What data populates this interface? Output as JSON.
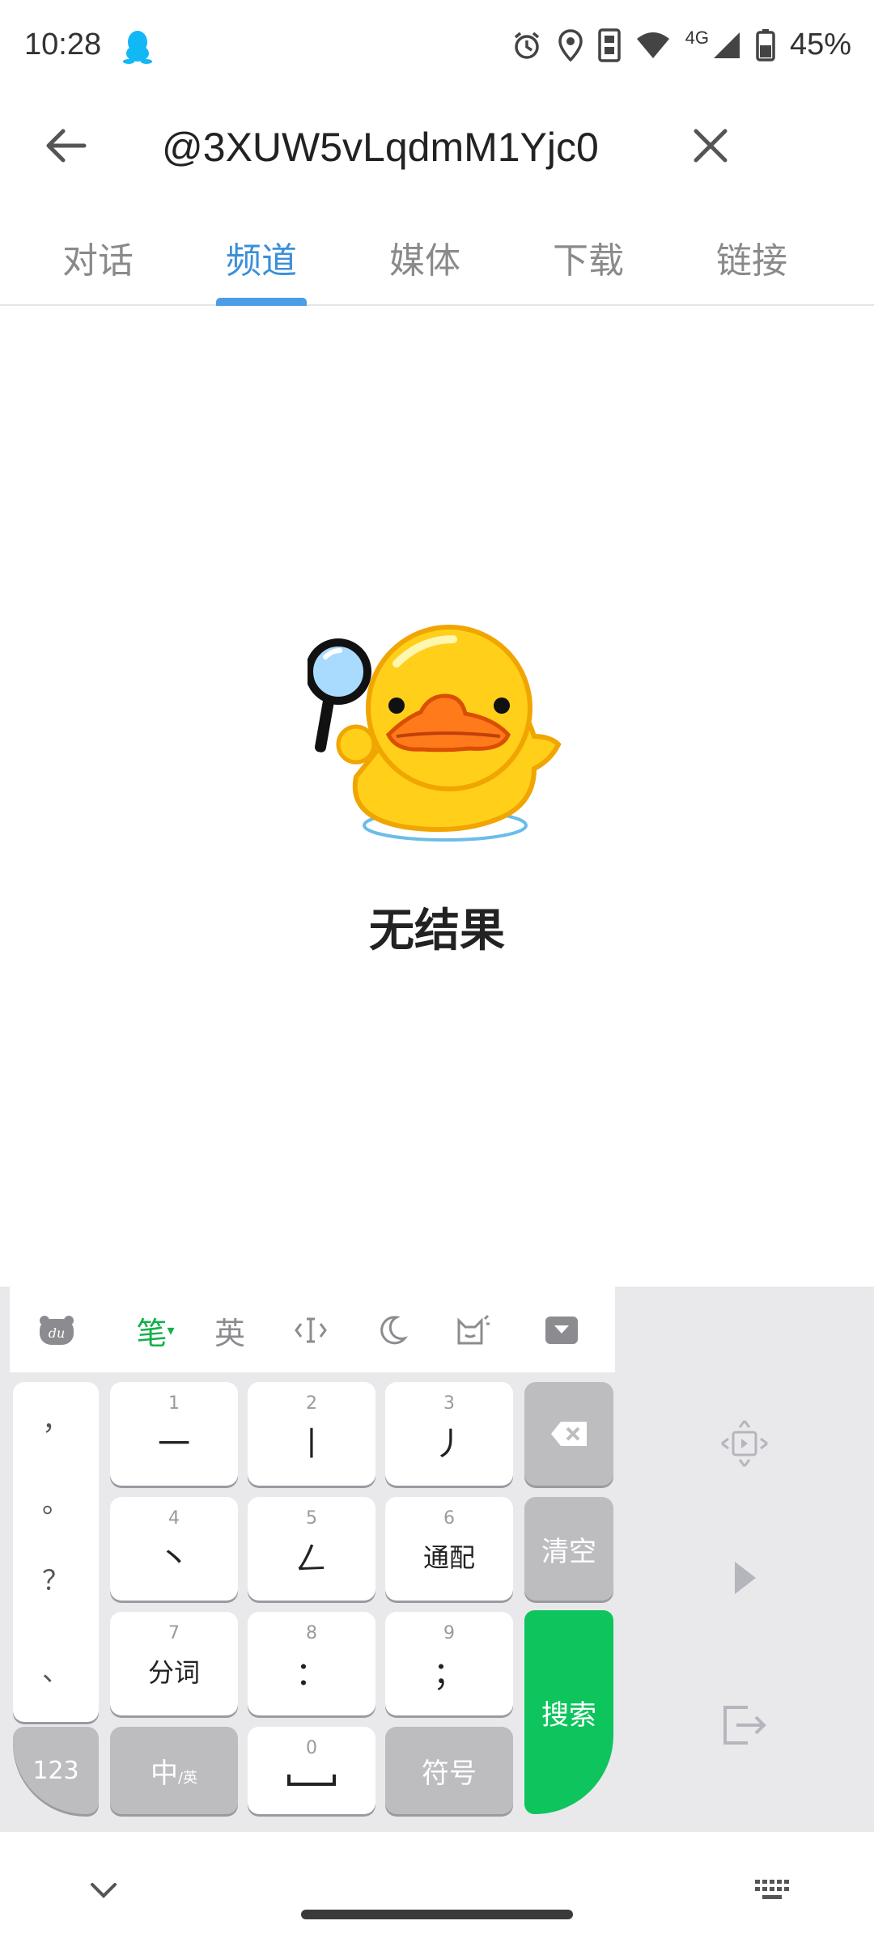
{
  "status_bar": {
    "time": "10:28",
    "battery": "45%",
    "network": "4G",
    "icons": [
      "qq-icon",
      "alarm-icon",
      "location-icon",
      "nfc-icon",
      "wifi-icon",
      "signal-icon",
      "battery-icon"
    ]
  },
  "search": {
    "query": "@3XUW5vLqdmM1Yjc0",
    "back_icon": "arrow-left-icon",
    "clear_icon": "close-icon"
  },
  "tabs": [
    {
      "label": "对话",
      "active": false
    },
    {
      "label": "频道",
      "active": true
    },
    {
      "label": "媒体",
      "active": false
    },
    {
      "label": "下载",
      "active": false
    },
    {
      "label": "链接",
      "active": false
    }
  ],
  "empty_state": {
    "text": "无结果",
    "illustration": "duck-with-magnifier"
  },
  "keyboard": {
    "toolbar": {
      "mode": "笔",
      "english": "英"
    },
    "punctuation": [
      "，",
      "。",
      "？",
      "、"
    ],
    "keys": [
      {
        "num": "1",
        "label": "一"
      },
      {
        "num": "2",
        "label": "丨"
      },
      {
        "num": "3",
        "label": "丿"
      },
      {
        "num": "4",
        "label": "丶"
      },
      {
        "num": "5",
        "label": "𠃋"
      },
      {
        "num": "6",
        "label": "通配"
      },
      {
        "num": "7",
        "label": "分词"
      },
      {
        "num": "8",
        "label": "："
      },
      {
        "num": "9",
        "label": "；"
      },
      {
        "num": "0",
        "label": "␣"
      }
    ],
    "clear_label": "清空",
    "search_label": "搜索",
    "num_label": "123",
    "lang_label": "中",
    "lang_sub": "/英",
    "symbol_label": "符号"
  },
  "colors": {
    "accent_blue": "#3c8fd9",
    "keyboard_green": "#0ec45d",
    "duck_yellow": "#ffcf1a"
  }
}
